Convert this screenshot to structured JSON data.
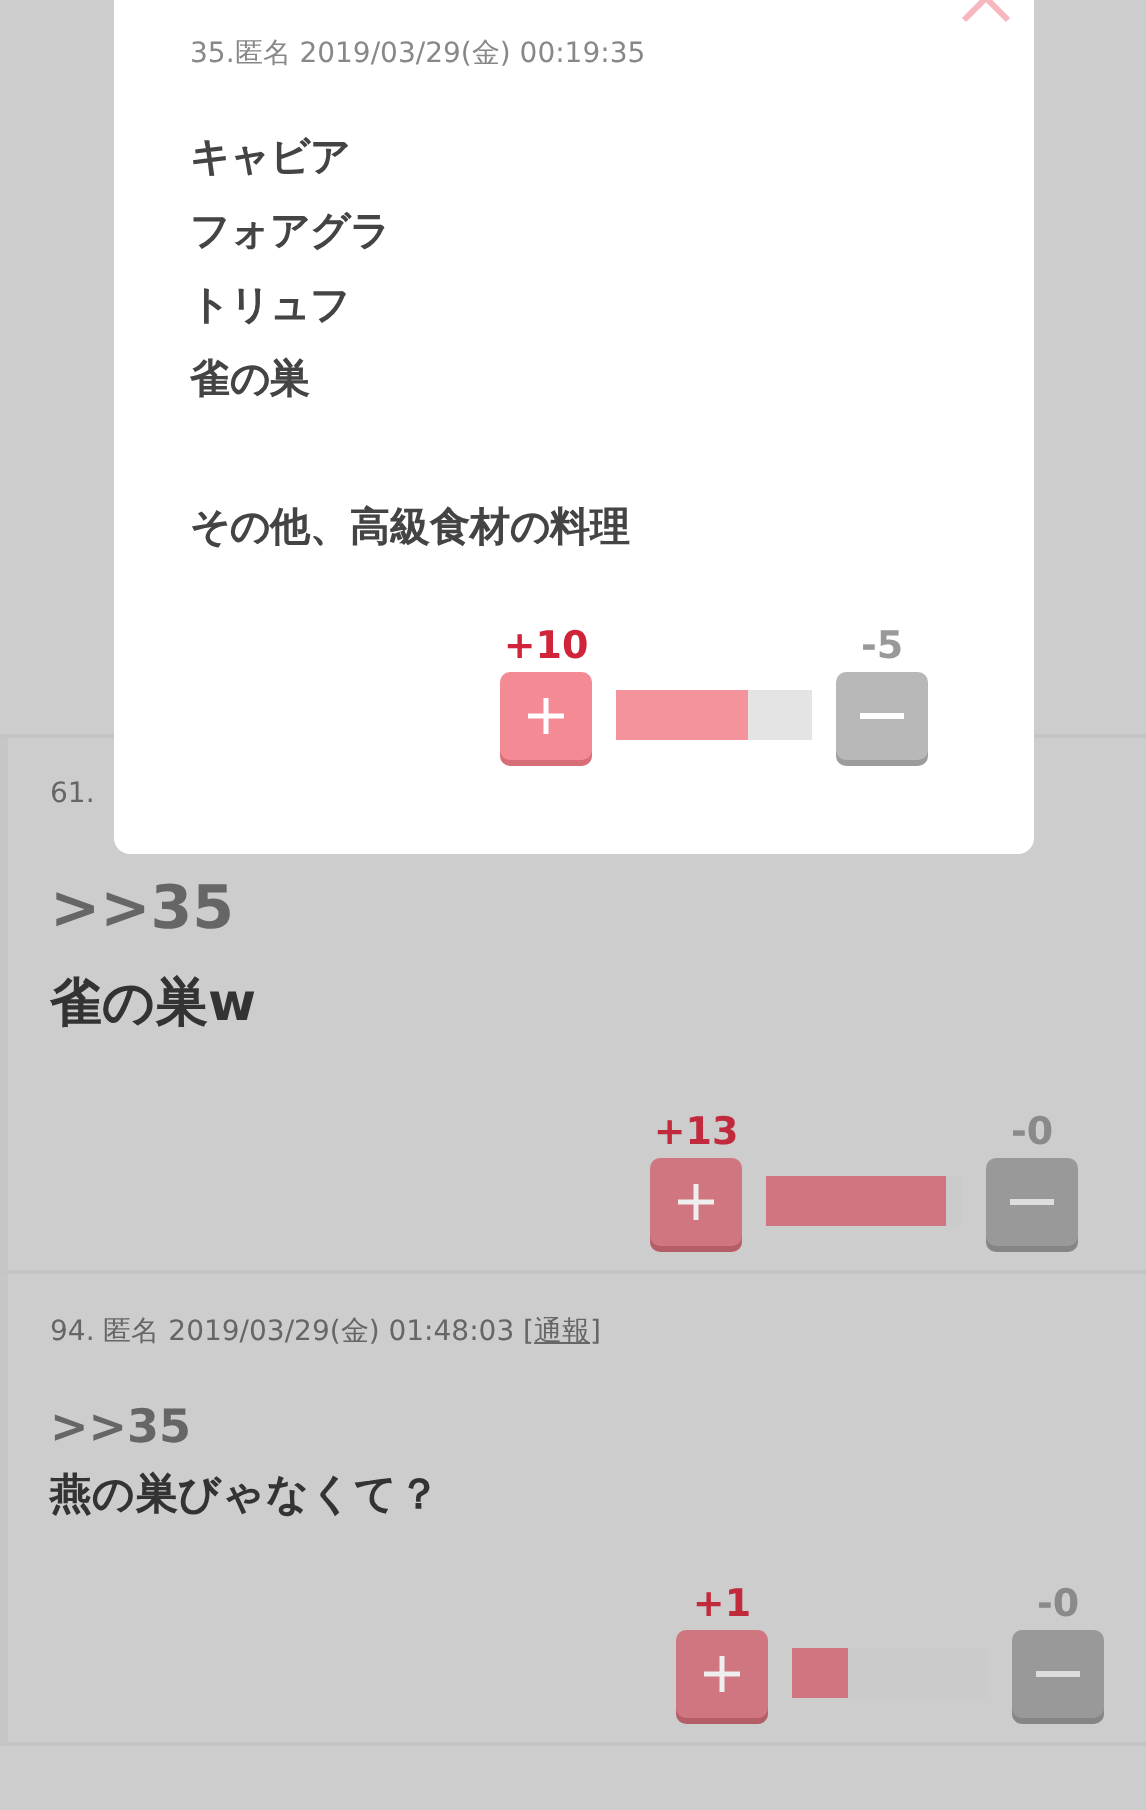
{
  "posts": [
    {
      "header": "61.",
      "quote": ">>35",
      "body": "雀の巣w",
      "votes": {
        "plus": "+13",
        "minus": "-0",
        "level": 0.92
      }
    },
    {
      "header": "94. 匿名 2019/03/29(金) 01:48:03 [",
      "report_link": "通報",
      "header_end": "]",
      "quote": ">>35",
      "body": "燕の巣びゃなくて？",
      "votes": {
        "plus": "+1",
        "minus": "-0",
        "level": 0.29
      }
    }
  ],
  "popup": {
    "header": "35.匿名 2019/03/29(金) 00:19:35",
    "paragraphs": [
      [
        "キャビア",
        "フォアグラ",
        "トリュフ",
        "雀の巣"
      ],
      [
        "その他、高級食材の料理"
      ]
    ],
    "votes": {
      "plus": "+10",
      "minus": "-5",
      "level": 0.67
    }
  }
}
